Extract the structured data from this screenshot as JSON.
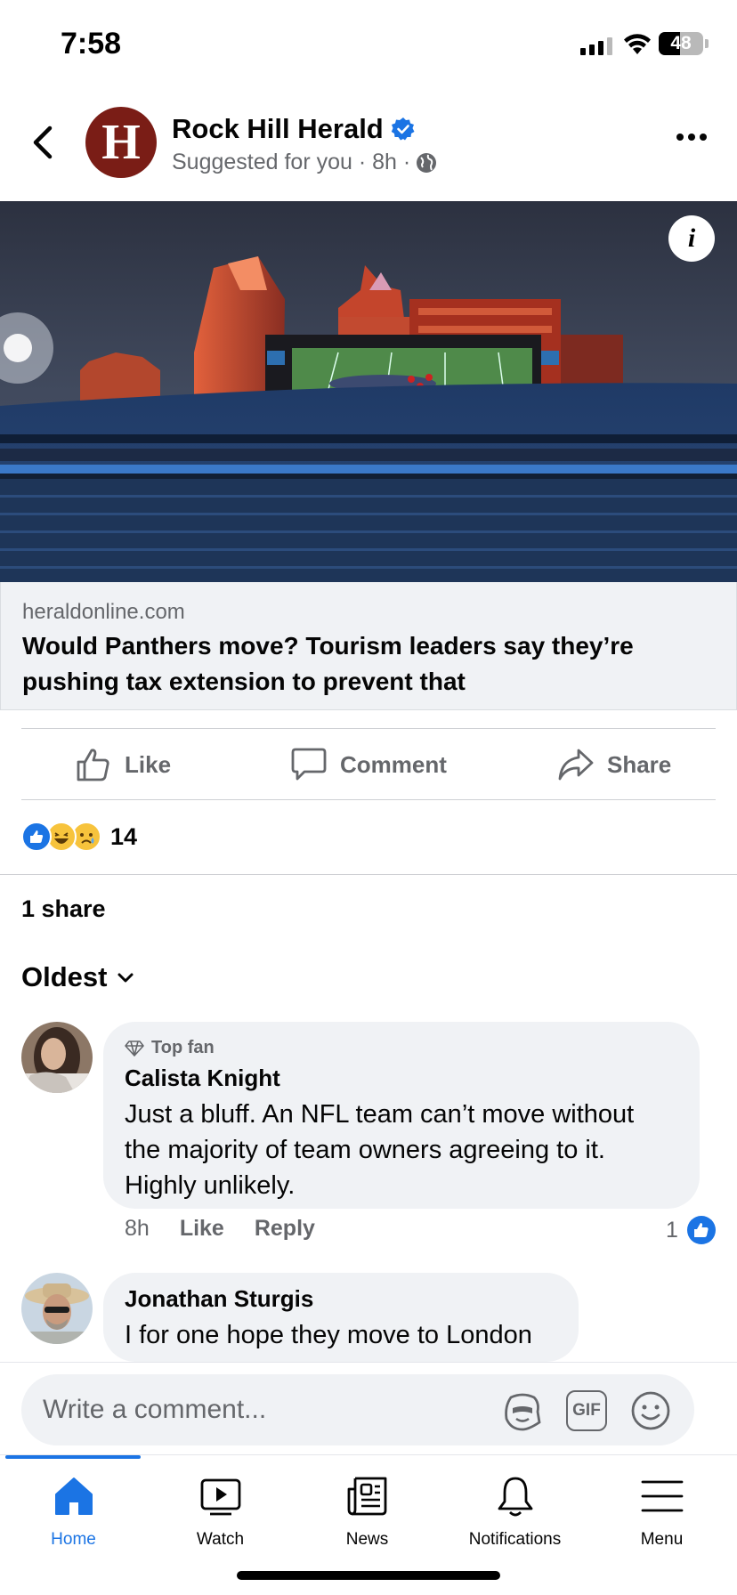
{
  "status_bar": {
    "time": "7:58",
    "battery": "48",
    "battery_level": 0.48
  },
  "post": {
    "page_name": "Rock Hill Herald",
    "avatar_letter": "H",
    "meta": "Suggested for you · 8h ·",
    "link": {
      "domain": "heraldonline.com",
      "title": "Would Panthers move? Tourism leaders say they’re pushing tax extension to prevent that"
    },
    "actions": {
      "like": "Like",
      "comment": "Comment",
      "share": "Share"
    },
    "reaction_count": "14",
    "share_count": "1 share"
  },
  "comments": {
    "sort_label": "Oldest",
    "items": [
      {
        "badge": "Top fan",
        "author": "Calista Knight",
        "lines": [
          "Just a bluff.  An NFL team can’t move without",
          "the majority of team owners agreeing to it.",
          "Highly unlikely."
        ],
        "time": "8h",
        "like": "Like",
        "reply": "Reply",
        "likes": "1"
      },
      {
        "author": "Jonathan Sturgis",
        "lines": [
          "I for one hope they move to London"
        ]
      }
    ]
  },
  "composer": {
    "placeholder": "Write a comment...",
    "gif_label": "GIF"
  },
  "tabs": [
    {
      "label": "Home",
      "active": true
    },
    {
      "label": "Watch"
    },
    {
      "label": "News"
    },
    {
      "label": "Notifications"
    },
    {
      "label": "Menu"
    }
  ],
  "colors": {
    "accent": "#1b74e4",
    "brand_avatar": "#7a1d16",
    "secondary_text": "#65676b"
  }
}
